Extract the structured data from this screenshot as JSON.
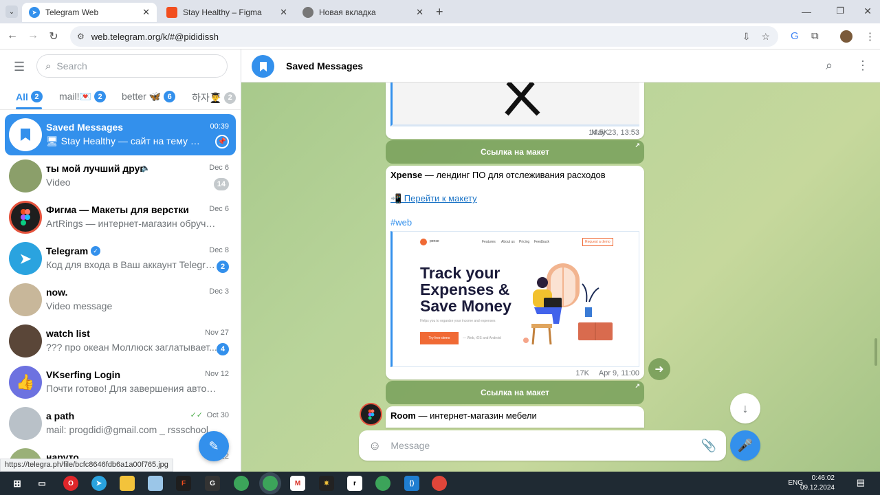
{
  "browser": {
    "tabs": [
      {
        "title": "Telegram Web",
        "active": true
      },
      {
        "title": "Stay Healthy – Figma",
        "active": false
      },
      {
        "title": "Новая вкладка",
        "active": false
      }
    ],
    "url": "web.telegram.org/k/#@pididissh",
    "status_url": "https://telegra.ph/file/bcfc8646fdb6a1a00f765.jpg"
  },
  "sidebar": {
    "search_placeholder": "Search",
    "folders": [
      {
        "label": "All",
        "count": "2"
      },
      {
        "label": "mail!💌",
        "count": "2"
      },
      {
        "label": "better 🦋",
        "count": "6"
      },
      {
        "label": "하자👨‍🎓",
        "count": "2"
      }
    ],
    "chats": [
      {
        "name": "Saved Messages",
        "date": "00:39",
        "preview": "🖥 Stay Healthy — сайт на тему спо...",
        "badge": ""
      },
      {
        "name": "ты мой лучший друг",
        "date": "Dec 6",
        "preview": "Video",
        "badge": "14"
      },
      {
        "name": "Фигма — Макеты для верстки",
        "date": "Dec 6",
        "preview": "ArtRings — интернет-магазин обручал...",
        "badge": ""
      },
      {
        "name": "Telegram",
        "date": "Dec 8",
        "preview": "Код для входа в Ваш аккаунт Telegra...",
        "badge": "2"
      },
      {
        "name": "now.",
        "date": "Dec 3",
        "preview": "Video message",
        "badge": ""
      },
      {
        "name": "watch list",
        "date": "Nov 27",
        "preview": "??? про океан Моллюск заглатывает...",
        "badge": "4"
      },
      {
        "name": "VKserfing Login",
        "date": "Nov 12",
        "preview": "Почти готово! Для завершения авториза...",
        "badge": ""
      },
      {
        "name": "a path",
        "date": "Oct 30",
        "preview": "mail: progdidi@gmail.com _ rssschool",
        "badge": ""
      },
      {
        "name": "наруто",
        "date": "Oct 22",
        "preview": "",
        "badge": ""
      }
    ]
  },
  "chat": {
    "title": "Saved Messages",
    "msg1": {
      "views": "14.5K",
      "date": "May 23, 13:53",
      "button": "Ссылка на макет"
    },
    "msg2": {
      "title_bold": "Xpense",
      "title_rest": " — лендинг ПО для отслеживания расходов",
      "link": "📲 Перейти к макету",
      "tag": "#web",
      "views": "17K",
      "date": "Apr 9, 11:00",
      "button": "Ссылка на макет",
      "preview": {
        "brand": "pense",
        "nav": [
          "Features",
          "About us",
          "Pricing",
          "Feedback"
        ],
        "cta": "Request a demo",
        "headline1": "Track your",
        "headline2": "Expenses &",
        "headline3": "Save Money",
        "sub": "Helps you to organize your income and expenses",
        "button": "Try free demo",
        "platforms": "— Web, iOS and Android"
      }
    },
    "msg3": {
      "title_bold": "Room",
      "title_rest": " — интернет-магазин мебели"
    },
    "composer_placeholder": "Message"
  },
  "taskbar": {
    "lang": "ENG",
    "time": "0:46:02",
    "date": "09.12.2024"
  },
  "colors": {
    "accent": "#3390ec",
    "link_button": "#78a05a"
  }
}
